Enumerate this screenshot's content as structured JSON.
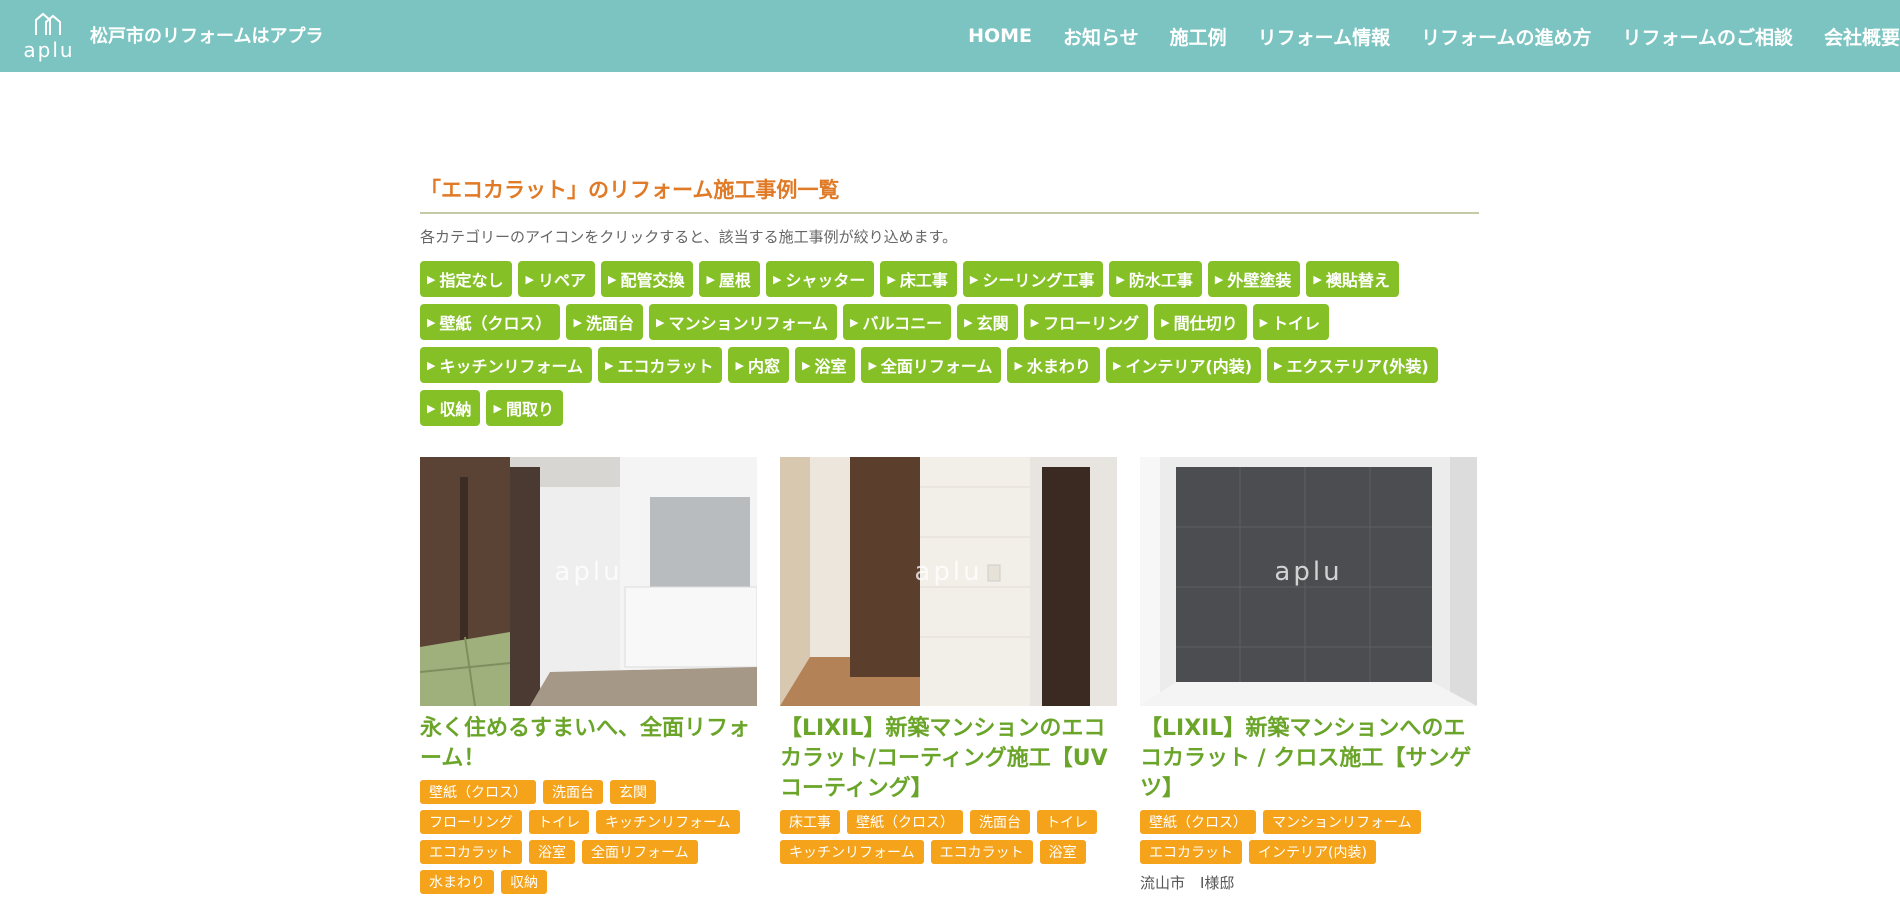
{
  "header": {
    "logo_text": "aplu",
    "site_title": "松戸市のリフォームはアプラ",
    "nav": [
      "HOME",
      "お知らせ",
      "施工例",
      "リフォーム情報",
      "リフォームの進め方",
      "リフォームのご相談",
      "会社概要"
    ]
  },
  "main": {
    "heading": "「エコカラット」のリフォーム施工事例一覧",
    "description": "各カテゴリーのアイコンをクリックすると、該当する施工事例が絞り込めます。",
    "categories": [
      "指定なし",
      "リペア",
      "配管交換",
      "屋根",
      "シャッター",
      "床工事",
      "シーリング工事",
      "防水工事",
      "外壁塗装",
      "襖貼替え",
      "壁紙（クロス）",
      "洗面台",
      "マンションリフォーム",
      "バルコニー",
      "玄関",
      "フローリング",
      "間仕切り",
      "トイレ",
      "キッチンリフォーム",
      "エコカラット",
      "内窓",
      "浴室",
      "全面リフォーム",
      "水まわり",
      "インテリア(内装)",
      "エクステリア(外装)",
      "収納",
      "間取り"
    ]
  },
  "cards": [
    {
      "title": "永く住めるすまいへ、全面リフォーム！",
      "watermark": "aplu",
      "tags": [
        "壁紙（クロス）",
        "洗面台",
        "玄関",
        "フローリング",
        "トイレ",
        "キッチンリフォーム",
        "エコカラット",
        "浴室",
        "全面リフォーム",
        "水まわり",
        "収納"
      ],
      "location": ""
    },
    {
      "title": "【LIXIL】新築マンションのエコカラット/コーティング施工【UVコーティング】",
      "watermark": "aplu",
      "tags": [
        "床工事",
        "壁紙（クロス）",
        "洗面台",
        "トイレ",
        "キッチンリフォーム",
        "エコカラット",
        "浴室"
      ],
      "location": ""
    },
    {
      "title": "【LIXIL】新築マンションへのエコカラット / クロス施工【サンゲツ】",
      "watermark": "aplu",
      "tags": [
        "壁紙（クロス）",
        "マンションリフォーム",
        "エコカラット",
        "インテリア(内装)"
      ],
      "location": "流山市　I様邸"
    }
  ]
}
